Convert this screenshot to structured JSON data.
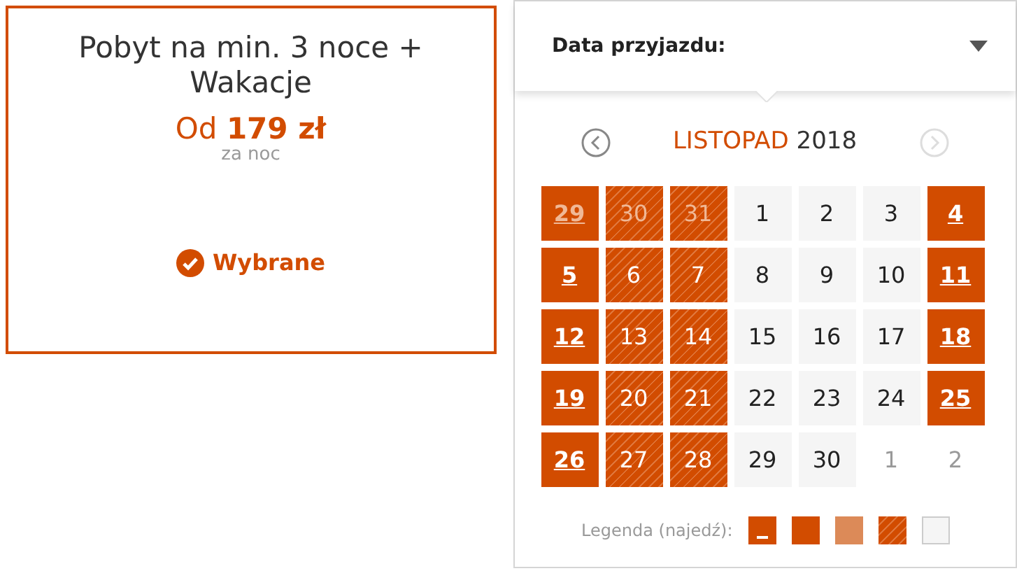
{
  "offer": {
    "title": "Pobyt na min. 3 noce + Wakacje",
    "price_prefix": "Od",
    "price": "179 zł",
    "price_unit": "za noc",
    "status": "Wybrane",
    "selected": true
  },
  "datepicker": {
    "label": "Data przyjazdu:",
    "expanded": true,
    "month": "LISTOPAD",
    "year": "2018",
    "prev_enabled": true,
    "next_enabled": false,
    "days": [
      {
        "label": "29",
        "kind": "arrival",
        "other_month": true
      },
      {
        "label": "30",
        "kind": "stay",
        "other_month": true
      },
      {
        "label": "31",
        "kind": "stay",
        "other_month": true
      },
      {
        "label": "1",
        "kind": "free",
        "other_month": false
      },
      {
        "label": "2",
        "kind": "free",
        "other_month": false
      },
      {
        "label": "3",
        "kind": "free",
        "other_month": false
      },
      {
        "label": "4",
        "kind": "arrival",
        "other_month": false
      },
      {
        "label": "5",
        "kind": "arrival",
        "other_month": false
      },
      {
        "label": "6",
        "kind": "stay",
        "other_month": false
      },
      {
        "label": "7",
        "kind": "stay",
        "other_month": false
      },
      {
        "label": "8",
        "kind": "free",
        "other_month": false
      },
      {
        "label": "9",
        "kind": "free",
        "other_month": false
      },
      {
        "label": "10",
        "kind": "free",
        "other_month": false
      },
      {
        "label": "11",
        "kind": "arrival",
        "other_month": false
      },
      {
        "label": "12",
        "kind": "arrival",
        "other_month": false
      },
      {
        "label": "13",
        "kind": "stay",
        "other_month": false
      },
      {
        "label": "14",
        "kind": "stay",
        "other_month": false
      },
      {
        "label": "15",
        "kind": "free",
        "other_month": false
      },
      {
        "label": "16",
        "kind": "free",
        "other_month": false
      },
      {
        "label": "17",
        "kind": "free",
        "other_month": false
      },
      {
        "label": "18",
        "kind": "arrival",
        "other_month": false
      },
      {
        "label": "19",
        "kind": "arrival",
        "other_month": false
      },
      {
        "label": "20",
        "kind": "stay",
        "other_month": false
      },
      {
        "label": "21",
        "kind": "stay",
        "other_month": false
      },
      {
        "label": "22",
        "kind": "free",
        "other_month": false
      },
      {
        "label": "23",
        "kind": "free",
        "other_month": false
      },
      {
        "label": "24",
        "kind": "free",
        "other_month": false
      },
      {
        "label": "25",
        "kind": "arrival",
        "other_month": false
      },
      {
        "label": "26",
        "kind": "arrival",
        "other_month": false
      },
      {
        "label": "27",
        "kind": "stay",
        "other_month": false
      },
      {
        "label": "28",
        "kind": "stay",
        "other_month": false
      },
      {
        "label": "29",
        "kind": "free",
        "other_month": false
      },
      {
        "label": "30",
        "kind": "free",
        "other_month": false
      },
      {
        "label": "1",
        "kind": "empty",
        "other_month": true
      },
      {
        "label": "2",
        "kind": "empty",
        "other_month": true
      }
    ],
    "legend_label": "Legenda (najedź):",
    "legend": [
      {
        "kind": "arrival"
      },
      {
        "kind": "solid"
      },
      {
        "kind": "light"
      },
      {
        "kind": "stay"
      },
      {
        "kind": "free"
      }
    ]
  }
}
